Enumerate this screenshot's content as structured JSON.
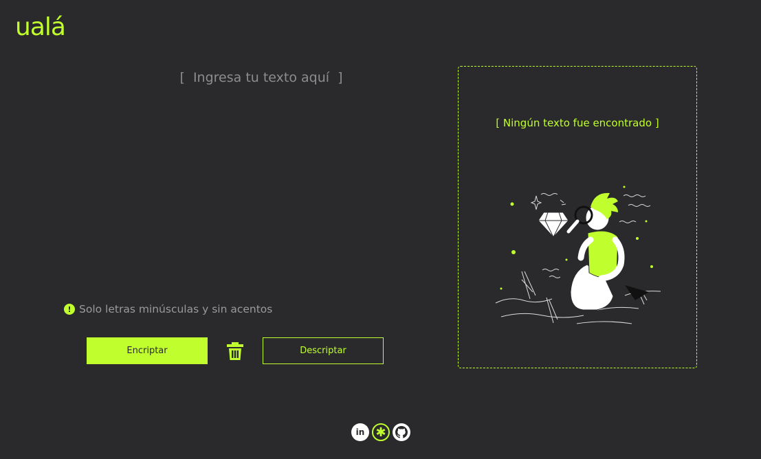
{
  "brand": {
    "logo_text": "ualá",
    "accent_color": "#c0ff2d",
    "background": "#2a2a2c"
  },
  "editor": {
    "placeholder": "[  Ingresa tu texto aquí  ]"
  },
  "hint": {
    "icon": "exclamation-circle-icon",
    "text": "Solo letras minúsculas y sin acentos"
  },
  "actions": {
    "encrypt_label": "Encriptar",
    "clear_icon": "trash-icon",
    "decrypt_label": "Descriptar"
  },
  "output": {
    "empty_message": "[ Ningún texto fue encontrado ]",
    "illustration": "person-searching-diamond-illustration"
  },
  "social": {
    "items": [
      {
        "name": "linkedin-icon",
        "label": "in"
      },
      {
        "name": "asterisk-icon",
        "label": "✱"
      },
      {
        "name": "github-icon",
        "label": ""
      }
    ]
  }
}
